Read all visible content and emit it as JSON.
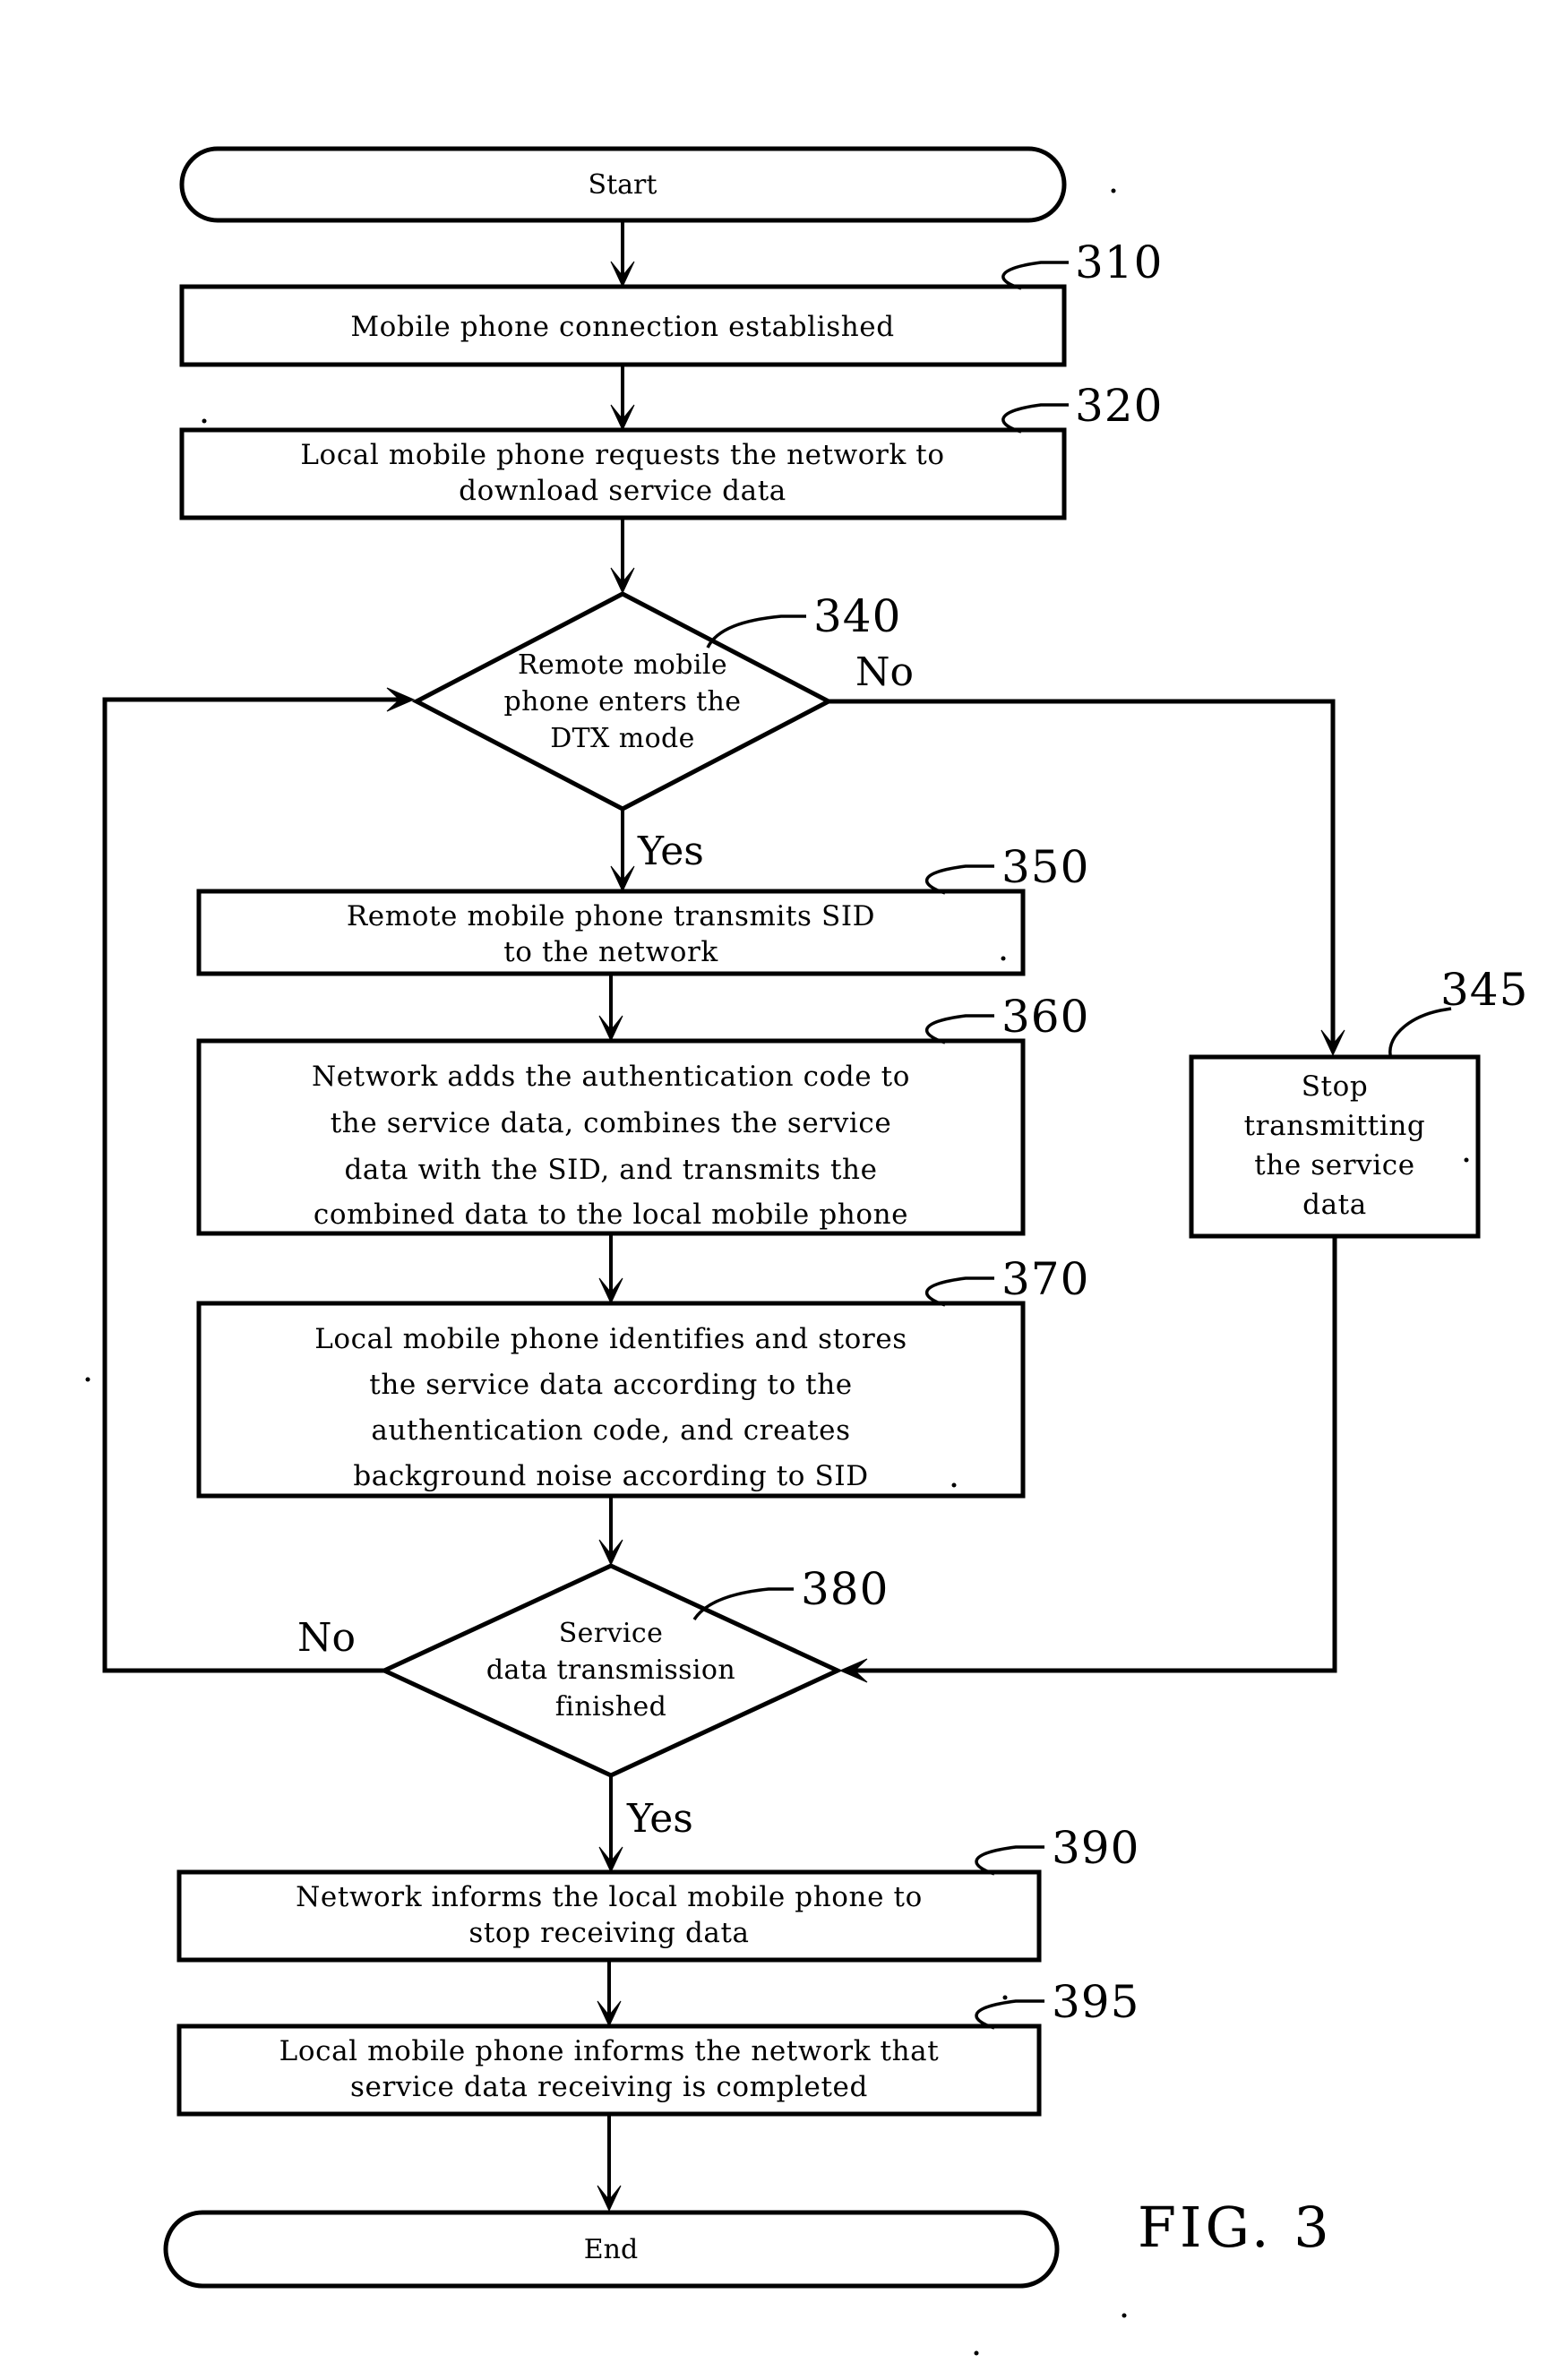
{
  "figure": {
    "label": "FIG. 3",
    "type": "flowchart"
  },
  "terminals": {
    "start": "Start",
    "end": "End"
  },
  "branch_labels": {
    "d340_no": "No",
    "d340_yes": "Yes",
    "d380_no": "No",
    "d380_yes": "Yes"
  },
  "nodes": [
    {
      "ref": "310",
      "shape": "process",
      "lines": [
        "Mobile phone connection established"
      ]
    },
    {
      "ref": "320",
      "shape": "process",
      "lines": [
        "Local mobile phone requests the network to",
        "download service data"
      ]
    },
    {
      "ref": "340",
      "shape": "decision",
      "lines": [
        "Remote mobile",
        "phone enters the",
        "DTX mode"
      ]
    },
    {
      "ref": "345",
      "shape": "process",
      "lines": [
        "Stop",
        "transmitting",
        "the service",
        "data"
      ]
    },
    {
      "ref": "350",
      "shape": "process",
      "lines": [
        "Remote mobile phone transmits SID",
        "to the network"
      ]
    },
    {
      "ref": "360",
      "shape": "process",
      "lines": [
        "Network adds the authentication code to",
        "the service data, combines the service",
        "data with the SID, and transmits the",
        "combined data to the local mobile phone"
      ]
    },
    {
      "ref": "370",
      "shape": "process",
      "lines": [
        "Local mobile phone identifies and stores",
        "the service data according to the",
        "authentication code, and creates",
        "background noise according to SID"
      ]
    },
    {
      "ref": "380",
      "shape": "decision",
      "lines": [
        "Service",
        "data transmission",
        "finished"
      ]
    },
    {
      "ref": "390",
      "shape": "process",
      "lines": [
        "Network informs the local mobile phone to",
        "stop receiving data"
      ]
    },
    {
      "ref": "395",
      "shape": "process",
      "lines": [
        "Local mobile phone informs the network that",
        "service data receiving is completed"
      ]
    }
  ],
  "ref_numbers": [
    "310",
    "320",
    "340",
    "345",
    "350",
    "360",
    "370",
    "380",
    "390",
    "395"
  ],
  "colors": {
    "ink": "#000000",
    "paper": "#ffffff"
  }
}
